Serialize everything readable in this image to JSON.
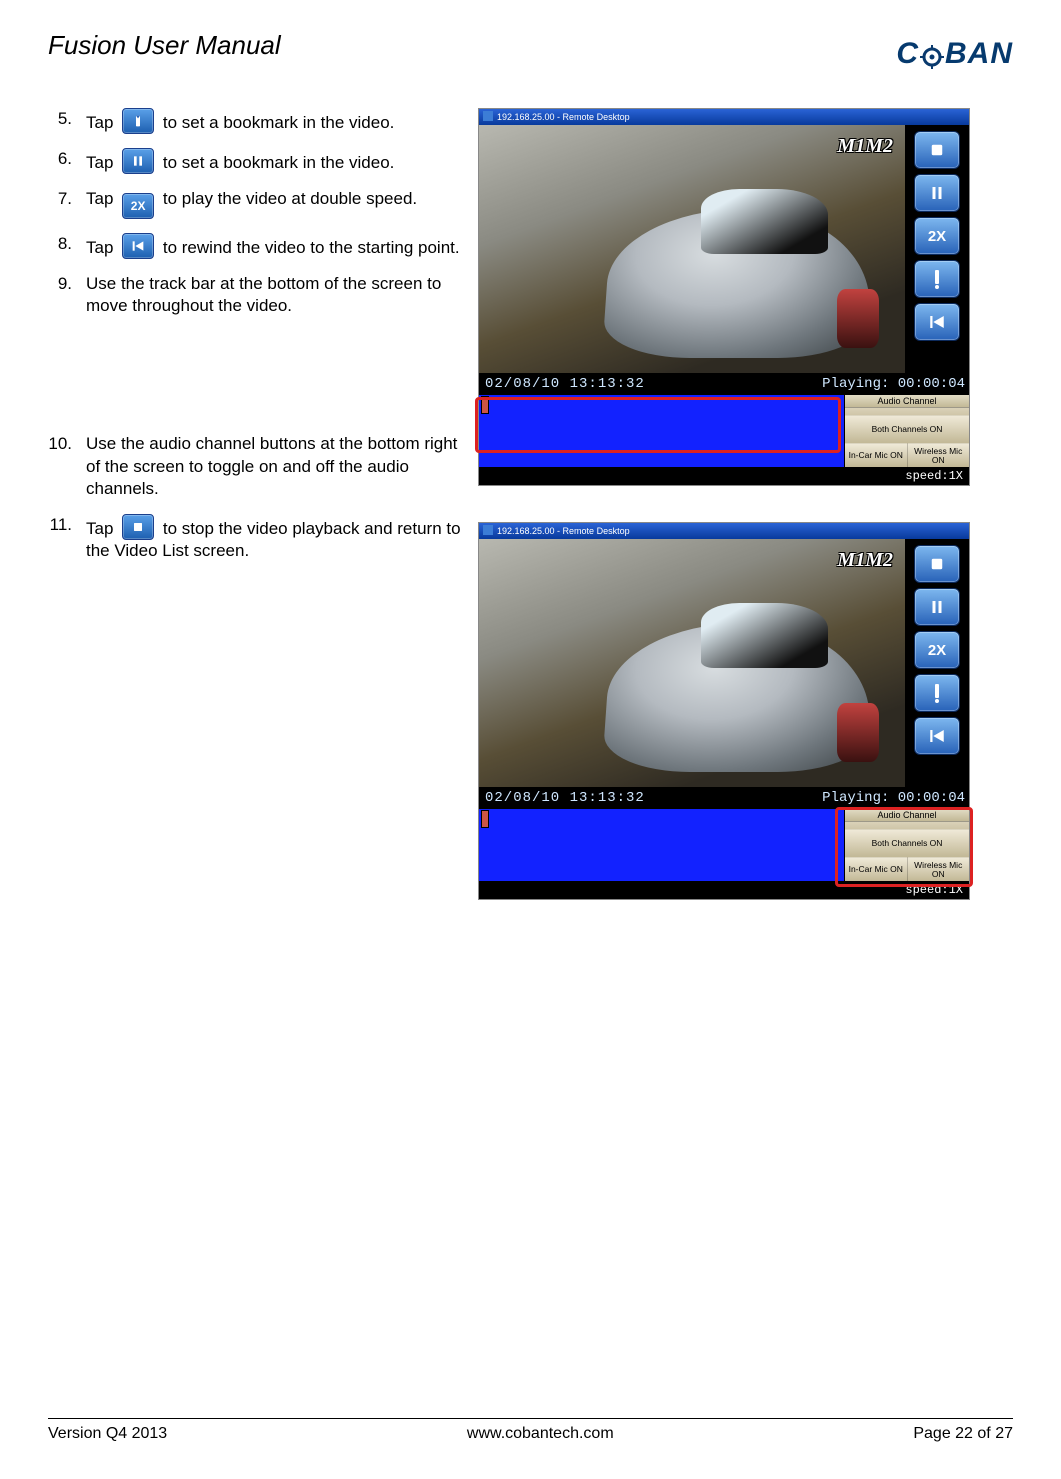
{
  "header": {
    "doc_title": "Fusion User Manual",
    "logo_text_left": "C",
    "logo_text_right": "BAN"
  },
  "steps": {
    "s5_num": "5.",
    "s5a": "Tap ",
    "s5b": " to set a bookmark in the video.",
    "s6_num": "6.",
    "s6a": "Tap ",
    "s6b": " to set a bookmark in the video.",
    "s7_num": "7.",
    "s7a": " Tap ",
    "s7b": " to play the video at double speed.",
    "s8_num": "8.",
    "s8a": "Tap ",
    "s8b": " to rewind the video to the starting point.",
    "s9_num": "9.",
    "s9": "Use the track bar at the bottom of the screen to move throughout the video.",
    "s10_num": "10.",
    "s10": "Use the audio channel buttons at the bottom right of the screen to toggle on and off the audio channels.",
    "s11_num": "11.",
    "s11a": "Tap ",
    "s11b": " to stop the video playback and return to the Video List screen."
  },
  "shot": {
    "titlebar": "192.168.25.00 - Remote Desktop",
    "watermark": "M1M2",
    "btn_2x": "2X",
    "timestamp": "02/08/10 13:13:32",
    "playing": "Playing: 00:00:04",
    "audio_header": "Audio Channel",
    "audio_both": "Both Channels ON",
    "audio_incar": "In-Car Mic ON",
    "audio_wireless": "Wireless Mic ON",
    "speed": "speed:1X"
  },
  "footer": {
    "version": "Version Q4 2013",
    "url": "www.cobantech.com",
    "page": "Page 22 of 27"
  }
}
